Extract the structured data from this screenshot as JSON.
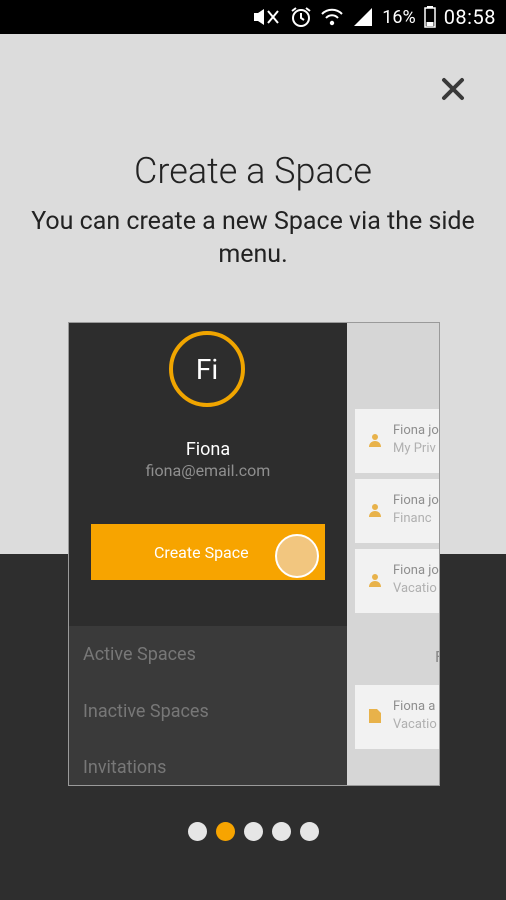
{
  "status_bar": {
    "battery": "16%",
    "time": "08:58"
  },
  "onboarding": {
    "title": "Create a Space",
    "subtitle": "You can create a new Space via the side menu."
  },
  "drawer": {
    "avatar_initials": "Fi",
    "user_name": "Fiona",
    "user_email": "fiona@email.com",
    "create_button_label": "Create Space",
    "items": [
      "Active Spaces",
      "Inactive Spaces",
      "Invitations"
    ]
  },
  "content_preview": {
    "cards": [
      {
        "line1": "Fiona jo",
        "line2": "My Priv",
        "icon": "person-icon"
      },
      {
        "line1": "Fiona jo",
        "line2": "Financ",
        "icon": "person-icon"
      },
      {
        "line1": "Fiona jo",
        "line2": "Vacatio",
        "icon": "person-icon"
      },
      {
        "line1": "Fiona a",
        "line2": "Vacatio",
        "icon": "document-icon"
      }
    ],
    "section_letter": "F"
  },
  "pager": {
    "count": 5,
    "active_index": 1
  },
  "colors": {
    "accent": "#f7a400",
    "dark": "#2d2d2d",
    "light": "#dcdcdc"
  }
}
